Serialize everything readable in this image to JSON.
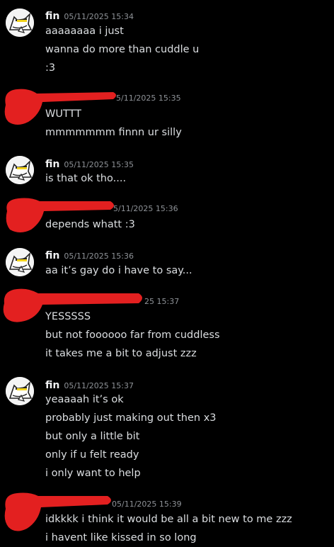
{
  "colors": {
    "background": "#000000",
    "author": "#f2f3f5",
    "timestamp": "#8e9297",
    "text": "#dbdee1",
    "redaction": "#e32020"
  },
  "messages": [
    {
      "author": "fin",
      "timestamp": "05/11/2025 15:34",
      "avatar_icon": "wolf-avatar-icon",
      "lines": [
        "aaaaaaaa i just",
        "wanna do more than cuddle u",
        ":3"
      ]
    },
    {
      "author": "",
      "redacted": true,
      "timestamp": "5/11/2025 15:35",
      "lines": [
        "WUTTT",
        "mmmmmmm finnn ur silly"
      ]
    },
    {
      "author": "fin",
      "timestamp": "05/11/2025 15:35",
      "avatar_icon": "wolf-avatar-icon",
      "lines": [
        "is that ok tho...."
      ]
    },
    {
      "author": "",
      "redacted": true,
      "timestamp": "5/11/2025 15:36",
      "lines": [
        "depends whatt :3"
      ]
    },
    {
      "author": "fin",
      "timestamp": "05/11/2025 15:36",
      "avatar_icon": "wolf-avatar-icon",
      "lines": [
        "aa it’s gay do i have to say..."
      ]
    },
    {
      "author": "",
      "redacted": true,
      "timestamp": "25 15:37",
      "lines": [
        "YESSSSS",
        "but not foooooo far from cuddless",
        "it takes me a bit to adjust zzz"
      ]
    },
    {
      "author": "fin",
      "timestamp": "05/11/2025 15:37",
      "avatar_icon": "wolf-avatar-icon",
      "lines": [
        "yeaaaah it’s ok",
        "probably just making out then x3",
        "but only a little bit",
        "only if u felt ready",
        "i only want to help"
      ]
    },
    {
      "author": "",
      "redacted": true,
      "timestamp": "05/11/2025 15:39",
      "lines": [
        "idkkkk i think it would be all a bit new to me zzz",
        "i havent like kissed in so long"
      ]
    }
  ]
}
